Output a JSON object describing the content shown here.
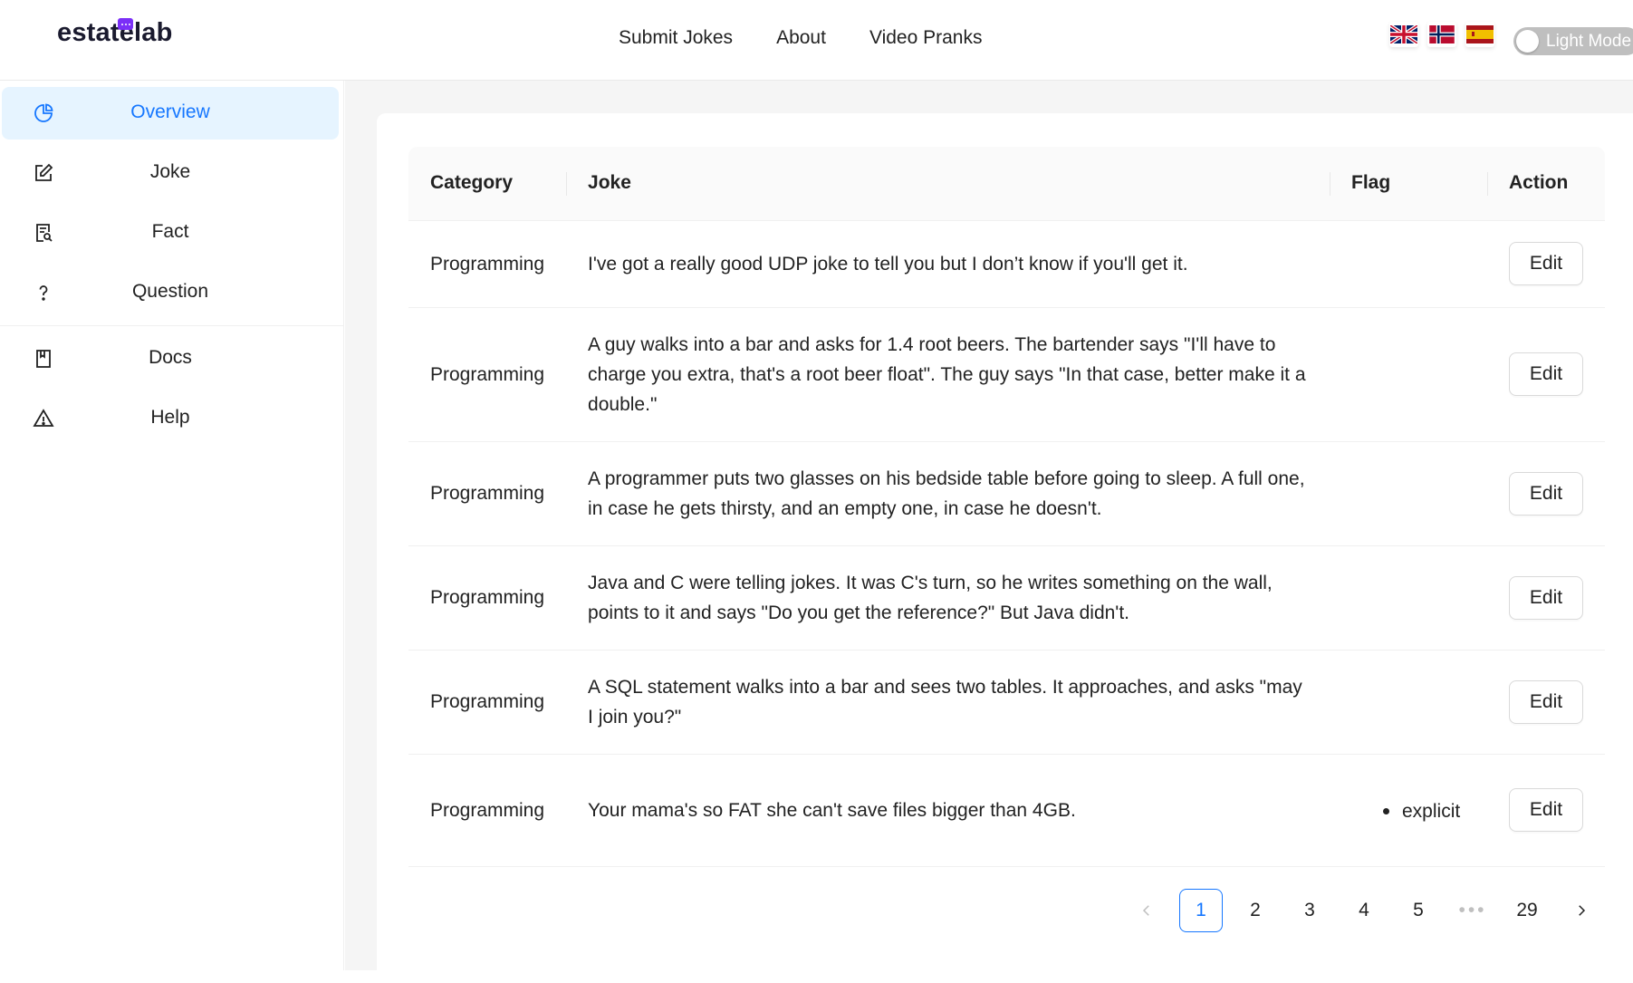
{
  "brand": {
    "name": "estatelab"
  },
  "topnav": [
    {
      "label": "Submit Jokes"
    },
    {
      "label": "About"
    },
    {
      "label": "Video Pranks"
    }
  ],
  "languages": [
    "English",
    "Norwegian",
    "Spanish"
  ],
  "theme_toggle": {
    "label": "Light Mode"
  },
  "sidebar": {
    "items": [
      {
        "label": "Overview",
        "icon": "pie-chart-icon",
        "active": true
      },
      {
        "label": "Joke",
        "icon": "edit-icon"
      },
      {
        "label": "Fact",
        "icon": "file-search-icon"
      },
      {
        "label": "Question",
        "icon": "question-icon"
      },
      {
        "label": "Docs",
        "icon": "book-icon"
      },
      {
        "label": "Help",
        "icon": "warning-icon"
      }
    ]
  },
  "table": {
    "headers": {
      "category": "Category",
      "joke": "Joke",
      "flag": "Flag",
      "action": "Action"
    },
    "edit_label": "Edit",
    "rows": [
      {
        "category": "Programming",
        "joke": "I've got a really good UDP joke to tell you but I don’t know if you'll get it.",
        "flag": ""
      },
      {
        "category": "Programming",
        "joke": "A guy walks into a bar and asks for 1.4 root beers. The bartender says \"I'll have to charge you extra, that's a root beer float\". The guy says \"In that case, better make it a double.\"",
        "flag": ""
      },
      {
        "category": "Programming",
        "joke": "A programmer puts two glasses on his bedside table before going to sleep. A full one, in case he gets thirsty, and an empty one, in case he doesn't.",
        "flag": ""
      },
      {
        "category": "Programming",
        "joke": "Java and C were telling jokes. It was C's turn, so he writes something on the wall, points to it and says \"Do you get the reference?\" But Java didn't.",
        "flag": ""
      },
      {
        "category": "Programming",
        "joke": "A SQL statement walks into a bar and sees two tables. It approaches, and asks \"may I join you?\"",
        "flag": ""
      },
      {
        "category": "Programming",
        "joke": "Your mama's so FAT she can't save files bigger than 4GB.",
        "flag": "explicit"
      }
    ]
  },
  "pagination": {
    "current": "1",
    "pages": [
      "1",
      "2",
      "3",
      "4",
      "5"
    ],
    "ellipsis": "•••",
    "last": "29"
  },
  "colors": {
    "accent": "#1677ff",
    "active_bg": "#e6f4ff",
    "brand_badge": "#7b2ff7"
  }
}
